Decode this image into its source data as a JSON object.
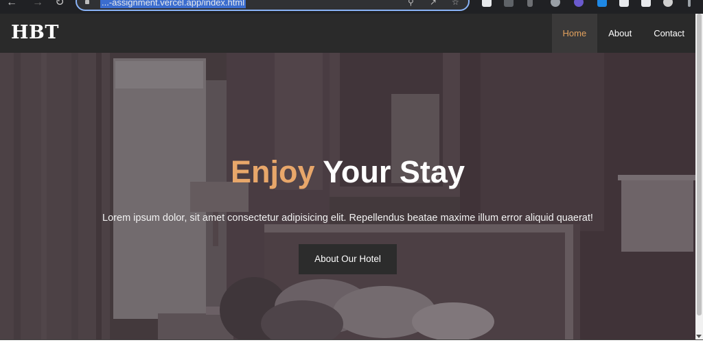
{
  "browser": {
    "url": "...-assignment.vercel.app/index.html",
    "icons": [
      "back-icon",
      "forward-icon",
      "reload-icon",
      "search-icon",
      "share-icon",
      "star-icon",
      "extension-icon"
    ]
  },
  "site": {
    "logo": "HBT",
    "nav": [
      {
        "label": "Home",
        "active": true
      },
      {
        "label": "About",
        "active": false
      },
      {
        "label": "Contact",
        "active": false
      }
    ]
  },
  "hero": {
    "title_accent": "Enjoy",
    "title_main": "Your Stay",
    "text": "Lorem ipsum dolor, sit amet consectetur adipisicing elit. Repellendus beatae maxime illum error aliquid quaerat!",
    "button": "About Our Hotel"
  },
  "colors": {
    "nav_bg": "#2a2a2a",
    "accent": "#e8a76a",
    "button_bg": "#2c2c2c"
  }
}
